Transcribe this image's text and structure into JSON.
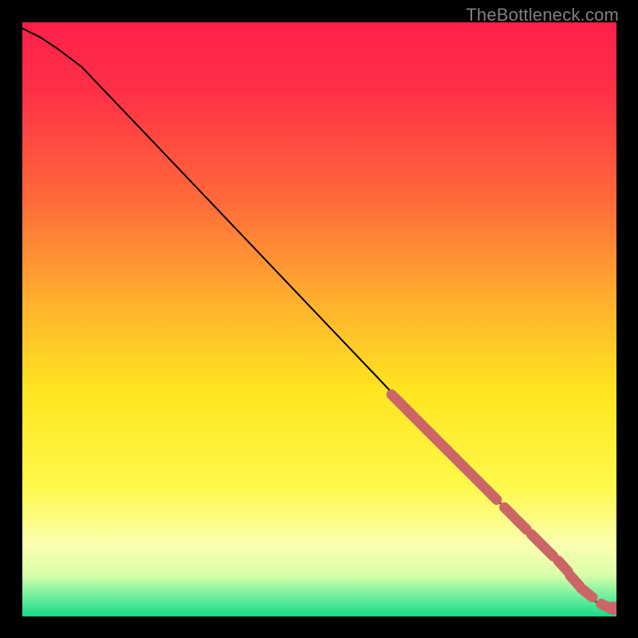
{
  "watermark": "TheBottleneck.com",
  "colors": {
    "gradient_stops": [
      {
        "offset": 0.0,
        "color": "#ff1f4a"
      },
      {
        "offset": 0.12,
        "color": "#ff3146"
      },
      {
        "offset": 0.3,
        "color": "#ff6a3a"
      },
      {
        "offset": 0.48,
        "color": "#ffb42d"
      },
      {
        "offset": 0.62,
        "color": "#ffe51f"
      },
      {
        "offset": 0.78,
        "color": "#fff94a"
      },
      {
        "offset": 0.88,
        "color": "#fbffb0"
      },
      {
        "offset": 0.93,
        "color": "#d9ffa8"
      },
      {
        "offset": 0.965,
        "color": "#74f09e"
      },
      {
        "offset": 1.0,
        "color": "#17d98a"
      }
    ],
    "curve": "#000000",
    "marker": "#cc6666"
  },
  "chart_data": {
    "type": "line",
    "title": "",
    "xlabel": "",
    "ylabel": "",
    "xlim": [
      0,
      100
    ],
    "ylim": [
      0,
      100
    ],
    "note": "Axes are unlabeled; values estimated from pixel positions on a 0–100 scale.",
    "series": [
      {
        "name": "curve",
        "x": [
          0,
          3,
          6,
          10,
          20,
          30,
          40,
          50,
          60,
          68,
          72,
          75,
          78,
          80,
          82,
          84,
          86,
          88,
          90,
          92,
          93.5,
          95,
          96.5,
          98,
          100
        ],
        "y": [
          99,
          97.5,
          95.5,
          92.5,
          82,
          71.5,
          61,
          50.5,
          40,
          31.5,
          27.5,
          24.5,
          21.5,
          19.5,
          17.5,
          15.5,
          13.5,
          11.5,
          9.5,
          7.0,
          5.5,
          4.0,
          2.5,
          1.5,
          1.5
        ]
      }
    ],
    "markers": {
      "name": "highlighted-points",
      "x": [
        63,
        64.5,
        66,
        67.5,
        69,
        71,
        73,
        75,
        77,
        79,
        82,
        84,
        86.5,
        88.5,
        91,
        93,
        95,
        98.5,
        100
      ],
      "y": [
        36.5,
        35,
        33.5,
        32,
        30.5,
        28.5,
        26.5,
        24.5,
        22.5,
        20.5,
        17.5,
        15.5,
        13,
        11,
        8.5,
        6,
        4,
        1.6,
        1.6
      ]
    }
  }
}
